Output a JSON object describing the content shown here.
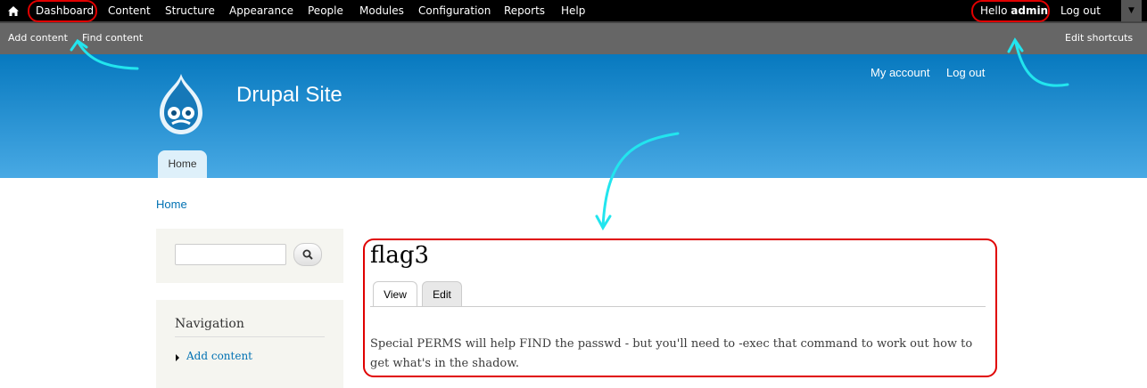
{
  "toolbar": {
    "menu": [
      "Dashboard",
      "Content",
      "Structure",
      "Appearance",
      "People",
      "Modules",
      "Configuration",
      "Reports",
      "Help"
    ],
    "hello_prefix": "Hello",
    "user": "admin",
    "logout": "Log out",
    "home_icon": "home-icon",
    "toggle_icon": "chevron-down-icon"
  },
  "shortcuts": {
    "add_content": "Add content",
    "find_content": "Find content",
    "edit_shortcuts": "Edit shortcuts"
  },
  "header": {
    "site_name": "Drupal Site",
    "my_account": "My account",
    "logout": "Log out",
    "home_tab": "Home",
    "logo_icon": "drupal-drop-icon"
  },
  "breadcrumb": "Home",
  "sidebar": {
    "search_icon": "search-icon",
    "nav_title": "Navigation",
    "nav_items": [
      "Add content"
    ]
  },
  "node": {
    "title": "flag3",
    "tabs": [
      "View",
      "Edit"
    ],
    "body": "Special PERMS will help FIND the passwd - but you'll need to -exec that command to work out how to get what's in the shadow."
  },
  "colors": {
    "annotation_red": "#e00000",
    "annotation_cyan": "#22e5ee",
    "header_top": "#0779bf",
    "header_bottom": "#48a9e4"
  }
}
